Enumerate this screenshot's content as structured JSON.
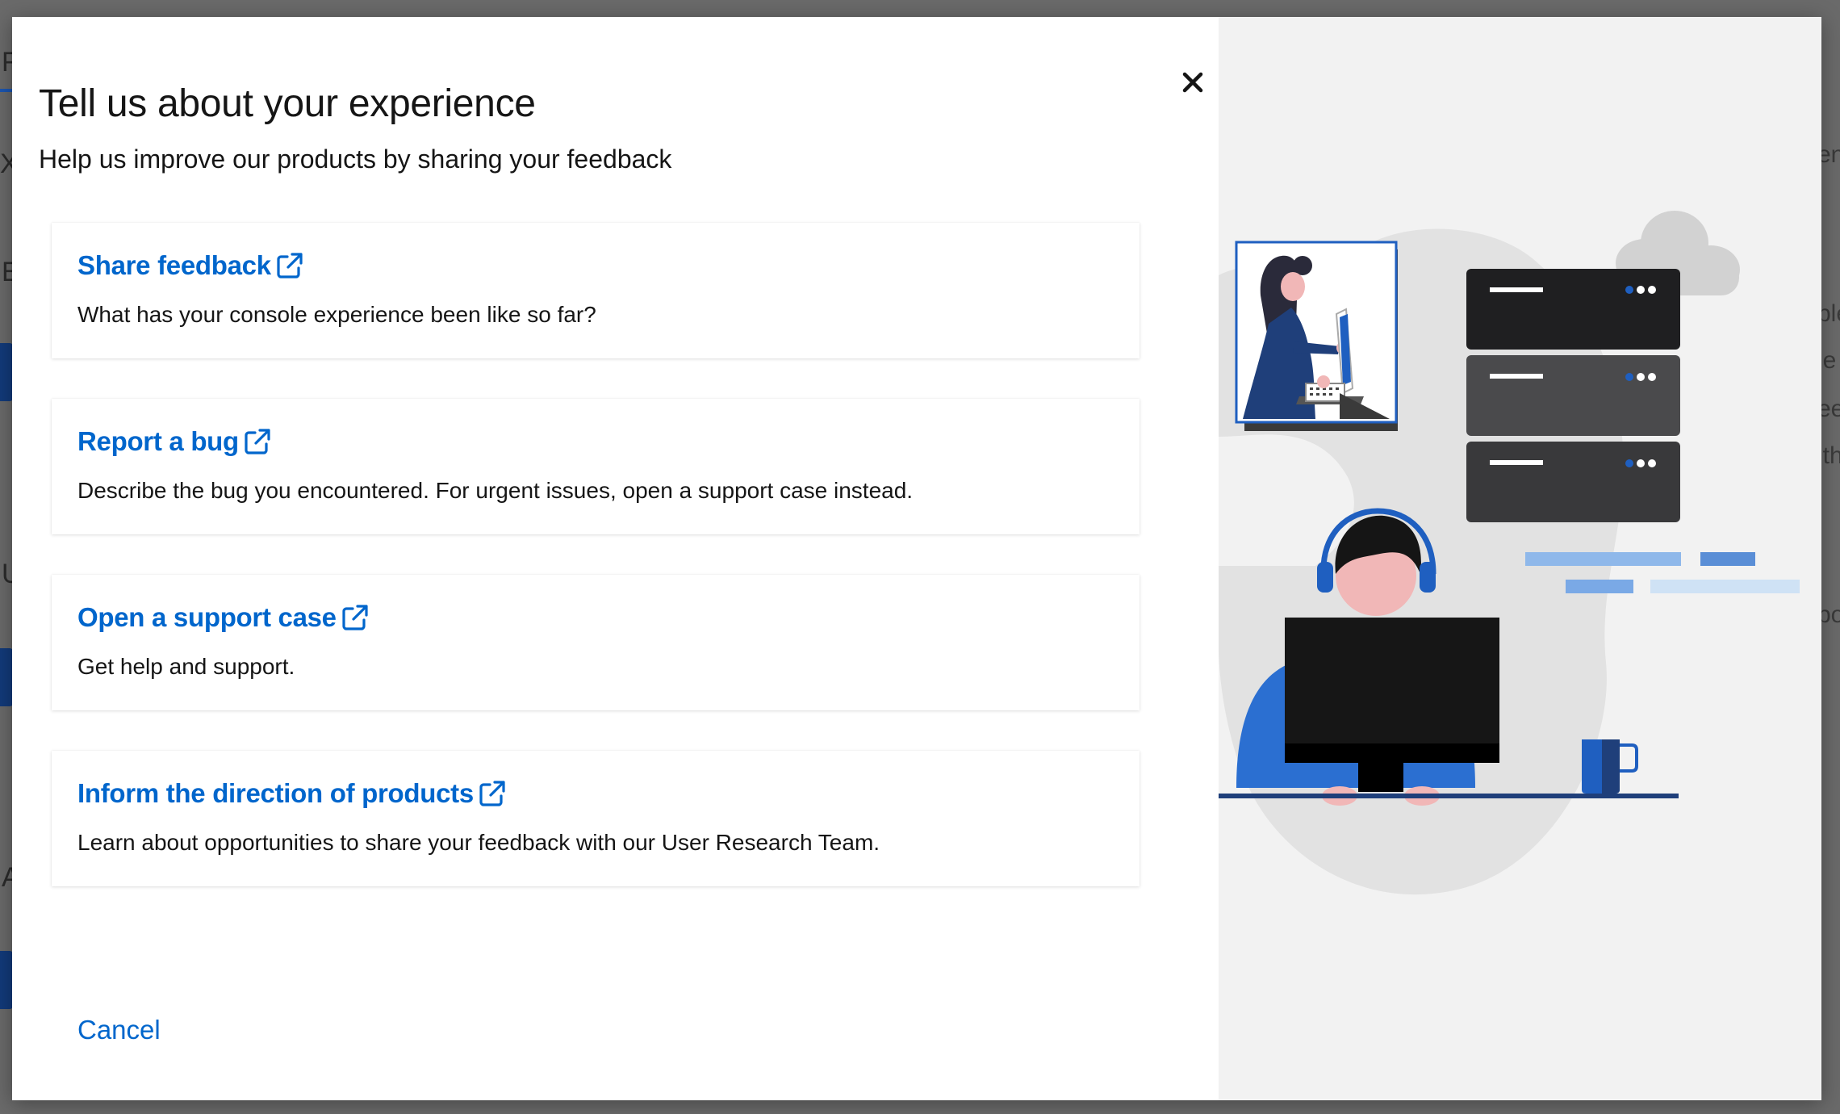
{
  "background": {
    "fragments_left": [
      "F",
      "X",
      "E",
      "U",
      "A"
    ],
    "fragments_right": [
      "en",
      "ple",
      "le",
      "ee",
      "ith",
      "po"
    ]
  },
  "modal": {
    "title": "Tell us about your experience",
    "subtitle": "Help us improve our products by sharing your feedback",
    "close_icon": "close-icon",
    "cards": [
      {
        "link": "Share feedback",
        "description": "What has your console experience been like so far?",
        "icon": "external-link-icon"
      },
      {
        "link": "Report a bug",
        "description": "Describe the bug you encountered. For urgent issues, open a support case instead.",
        "icon": "external-link-icon"
      },
      {
        "link": "Open a support case",
        "description": "Get help and support.",
        "icon": "external-link-icon"
      },
      {
        "link": "Inform the direction of products",
        "description": "Learn about opportunities to share your feedback with our User Research Team.",
        "icon": "external-link-icon"
      }
    ],
    "cancel_label": "Cancel"
  },
  "colors": {
    "link": "#0066cc",
    "text": "#151515",
    "panel_bg": "#f2f2f2",
    "illustration_blue": "#1f5fc0",
    "illustration_dark_blue": "#1f3f7a"
  }
}
